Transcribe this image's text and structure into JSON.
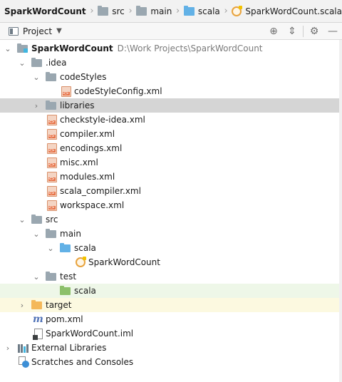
{
  "breadcrumb": {
    "items": [
      {
        "label": "SparkWordCount",
        "icon": "module-folder-icon"
      },
      {
        "label": "src",
        "icon": "folder-icon"
      },
      {
        "label": "main",
        "icon": "folder-icon"
      },
      {
        "label": "scala",
        "icon": "source-folder-icon"
      },
      {
        "label": "SparkWordCount.scala",
        "icon": "scala-object-icon"
      }
    ]
  },
  "toolbar": {
    "title": "Project",
    "dropdown_glyph": "▼",
    "actions": [
      {
        "name": "locate-icon",
        "glyph": "⊕"
      },
      {
        "name": "collapse-all-icon",
        "glyph": "⇕"
      },
      {
        "name": "settings-icon",
        "glyph": "⚙"
      },
      {
        "name": "hide-icon",
        "glyph": "—"
      }
    ]
  },
  "tree": {
    "rows": [
      {
        "label": "SparkWordCount",
        "path": "D:\\Work Projects\\SparkWordCount",
        "expanded": true,
        "icon": "module-folder-icon"
      },
      {
        "label": ".idea",
        "expanded": true,
        "icon": "folder-icon"
      },
      {
        "label": "codeStyles",
        "expanded": true,
        "icon": "folder-icon"
      },
      {
        "label": "codeStyleConfig.xml",
        "icon": "xml-file-icon"
      },
      {
        "label": "libraries",
        "expanded": false,
        "icon": "folder-icon",
        "selected": true
      },
      {
        "label": "checkstyle-idea.xml",
        "icon": "xml-file-icon"
      },
      {
        "label": "compiler.xml",
        "icon": "xml-file-icon"
      },
      {
        "label": "encodings.xml",
        "icon": "xml-file-icon"
      },
      {
        "label": "misc.xml",
        "icon": "xml-file-icon"
      },
      {
        "label": "modules.xml",
        "icon": "xml-file-icon"
      },
      {
        "label": "scala_compiler.xml",
        "icon": "xml-file-icon"
      },
      {
        "label": "workspace.xml",
        "icon": "xml-file-icon"
      },
      {
        "label": "src",
        "expanded": true,
        "icon": "folder-icon"
      },
      {
        "label": "main",
        "expanded": true,
        "icon": "folder-icon"
      },
      {
        "label": "scala",
        "expanded": true,
        "icon": "source-folder-icon"
      },
      {
        "label": "SparkWordCount",
        "icon": "scala-object-icon"
      },
      {
        "label": "test",
        "expanded": true,
        "icon": "folder-icon"
      },
      {
        "label": "scala",
        "icon": "test-source-folder-icon",
        "highlight": "green"
      },
      {
        "label": "target",
        "expanded": false,
        "icon": "excluded-folder-icon",
        "highlight": "yellow"
      },
      {
        "label": "pom.xml",
        "icon": "maven-icon"
      },
      {
        "label": "SparkWordCount.iml",
        "icon": "iml-file-icon"
      },
      {
        "label": "External Libraries",
        "expanded": false,
        "icon": "external-libraries-icon"
      },
      {
        "label": "Scratches and Consoles",
        "icon": "scratches-icon"
      }
    ]
  },
  "colors": {
    "selected_row": "#d5d5d5",
    "test_folder_row": "#eef7e8",
    "excluded_folder_row": "#fcf9e0",
    "source_folder": "#62b1e6",
    "test_folder": "#8cc06a",
    "excluded_folder": "#f4b85a"
  }
}
